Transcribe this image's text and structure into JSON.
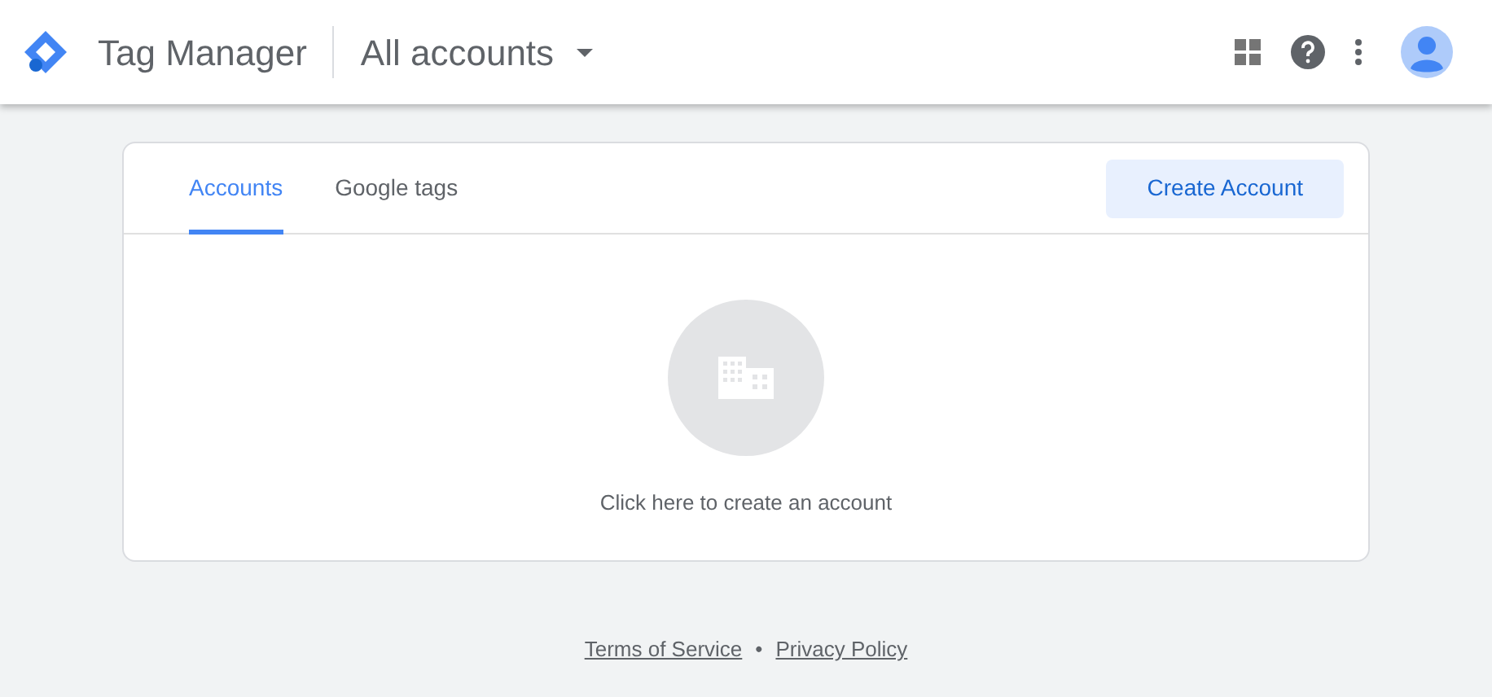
{
  "header": {
    "product": "Tag Manager",
    "account_picker": "All accounts"
  },
  "tabs": [
    {
      "label": "Accounts",
      "selected": true
    },
    {
      "label": "Google tags",
      "selected": false
    }
  ],
  "create_button": "Create Account",
  "empty_state": {
    "text": "Click here to create an account"
  },
  "footer": {
    "links": [
      "Terms of Service",
      "Privacy Policy"
    ],
    "separator": "•"
  }
}
